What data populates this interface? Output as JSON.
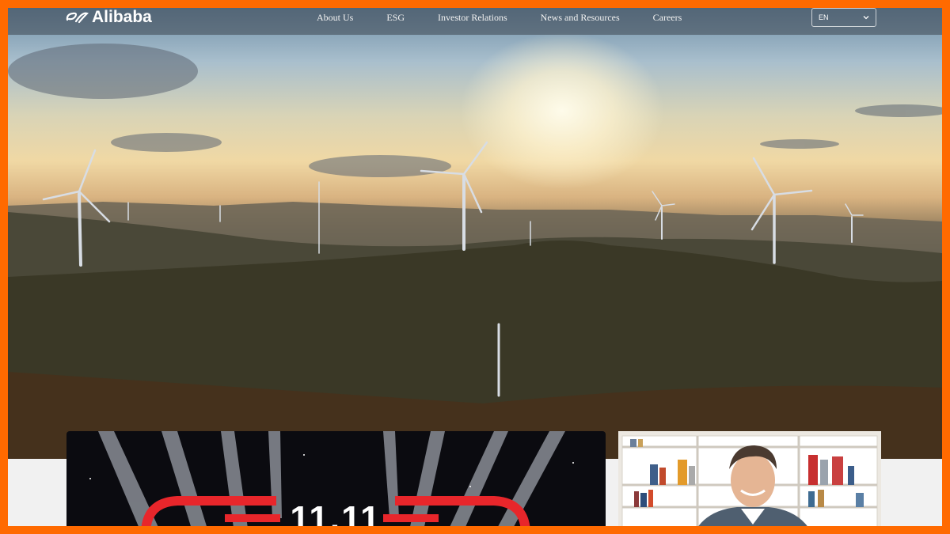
{
  "brand": {
    "name": "Alibaba"
  },
  "nav": {
    "items": [
      {
        "label": "About Us"
      },
      {
        "label": "ESG"
      },
      {
        "label": "Investor Relations"
      },
      {
        "label": "News and Resources"
      },
      {
        "label": "Careers"
      }
    ]
  },
  "language": {
    "selected": "EN"
  },
  "cards": {
    "shopping_festival": {
      "badge": "11.11"
    }
  },
  "colors": {
    "frame": "#ff6a00",
    "festival_red": "#e8262b"
  }
}
